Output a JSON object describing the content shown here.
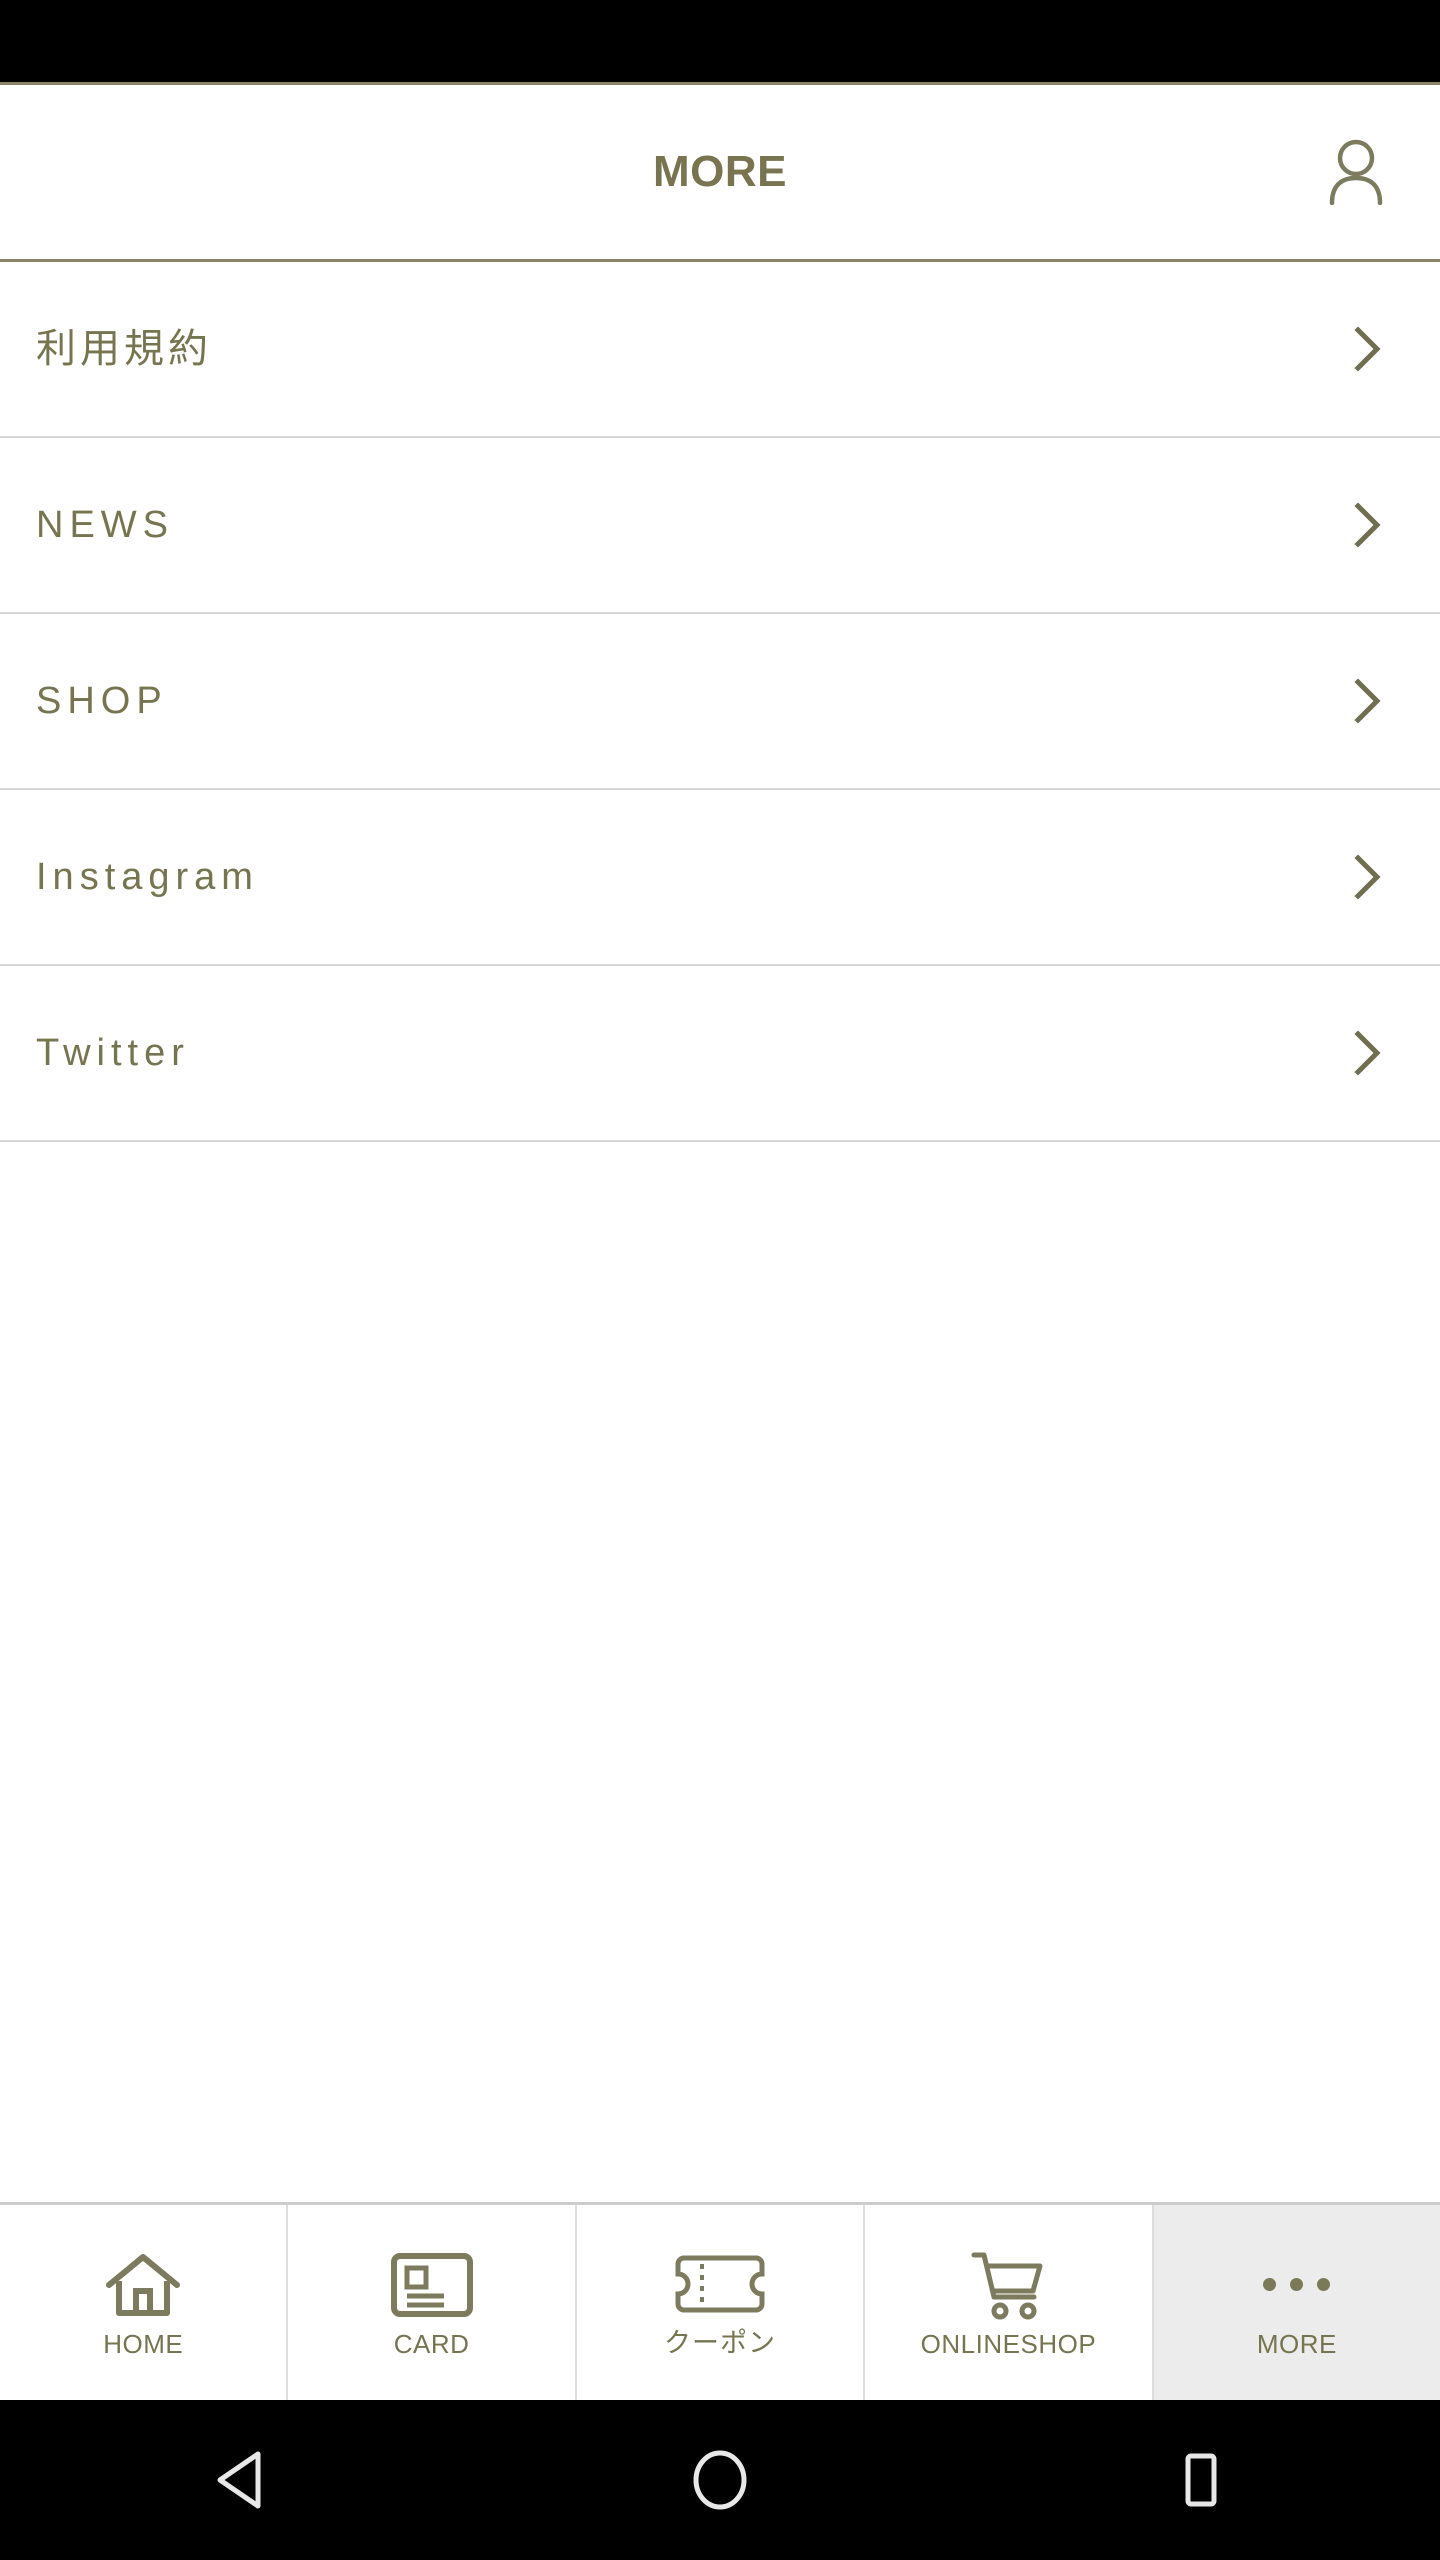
{
  "header": {
    "title": "MORE",
    "account_icon": "person-icon"
  },
  "menu": {
    "items": [
      {
        "label": "利用規約",
        "lang": "jp",
        "chevron": "chevron-right-icon"
      },
      {
        "label": "NEWS",
        "lang": "en",
        "chevron": "chevron-right-icon"
      },
      {
        "label": "SHOP",
        "lang": "en",
        "chevron": "chevron-right-icon"
      },
      {
        "label": "Instagram",
        "lang": "en",
        "chevron": "chevron-right-icon"
      },
      {
        "label": "Twitter",
        "lang": "en",
        "chevron": "chevron-right-icon"
      }
    ]
  },
  "tabbar": {
    "tabs": [
      {
        "label": "HOME",
        "icon": "home-icon",
        "lang": "en",
        "active": false
      },
      {
        "label": "CARD",
        "icon": "card-icon",
        "lang": "en",
        "active": false
      },
      {
        "label": "クーポン",
        "icon": "ticket-icon",
        "lang": "jp",
        "active": false
      },
      {
        "label": "ONLINESHOP",
        "icon": "shopping-cart-icon",
        "lang": "en",
        "active": false
      },
      {
        "label": "MORE",
        "icon": "more-dots-icon",
        "lang": "en",
        "active": true
      }
    ]
  },
  "android_nav": {
    "back": "back-triangle-icon",
    "home": "home-circle-icon",
    "recents": "recents-square-icon"
  },
  "colors": {
    "accent": "#77744f",
    "border_accent": "#8a8468",
    "divider": "#d6d6d6",
    "tab_active_bg": "#ececec",
    "status_bar": "#000000",
    "background": "#ffffff"
  }
}
